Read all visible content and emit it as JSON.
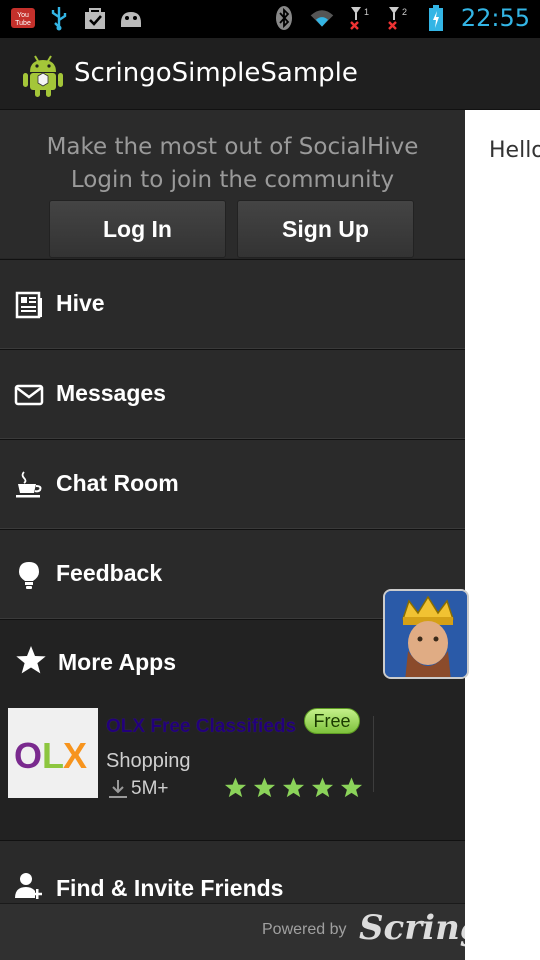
{
  "status_bar": {
    "time": "22:55",
    "left_icons": [
      "youtube-icon",
      "usb-icon",
      "shopping-bag-icon",
      "android-debug-icon"
    ],
    "right_icons": [
      "bluetooth-icon",
      "wifi-icon",
      "signal-1-icon",
      "signal-2-icon",
      "battery-icon"
    ],
    "sim1_label": "1",
    "sim2_label": "2"
  },
  "action_bar": {
    "title": "ScringoSimpleSample",
    "icon": "android-app-icon"
  },
  "content": {
    "text": "Hello"
  },
  "drawer": {
    "login_prompt": {
      "line1": "Make the most out of SocialHive",
      "line2": "Login to join the community",
      "login_label": "Log In",
      "signup_label": "Sign Up"
    },
    "menu": [
      {
        "label": "Hive",
        "icon": "newspaper-icon"
      },
      {
        "label": "Messages",
        "icon": "envelope-icon"
      },
      {
        "label": "Chat Room",
        "icon": "coffee-cup-icon"
      },
      {
        "label": "Feedback",
        "icon": "lightbulb-icon"
      }
    ],
    "more_apps": {
      "title": "More Apps",
      "icon": "star-icon",
      "app": {
        "name": "OLX Free Classifieds",
        "badge": "Free",
        "category": "Shopping",
        "downloads": "5M+",
        "rating": 5,
        "logo_text": "OLX"
      }
    },
    "find_friends": {
      "label": "Find & Invite Friends",
      "icon": "add-person-icon"
    },
    "footer": {
      "powered_by": "Powered by",
      "brand": "Scringo"
    }
  },
  "colors": {
    "clock": "#33b5e5",
    "drawer_bg": "#262626",
    "badge_green": "#8fd14f",
    "star_green": "#8bd35a"
  }
}
